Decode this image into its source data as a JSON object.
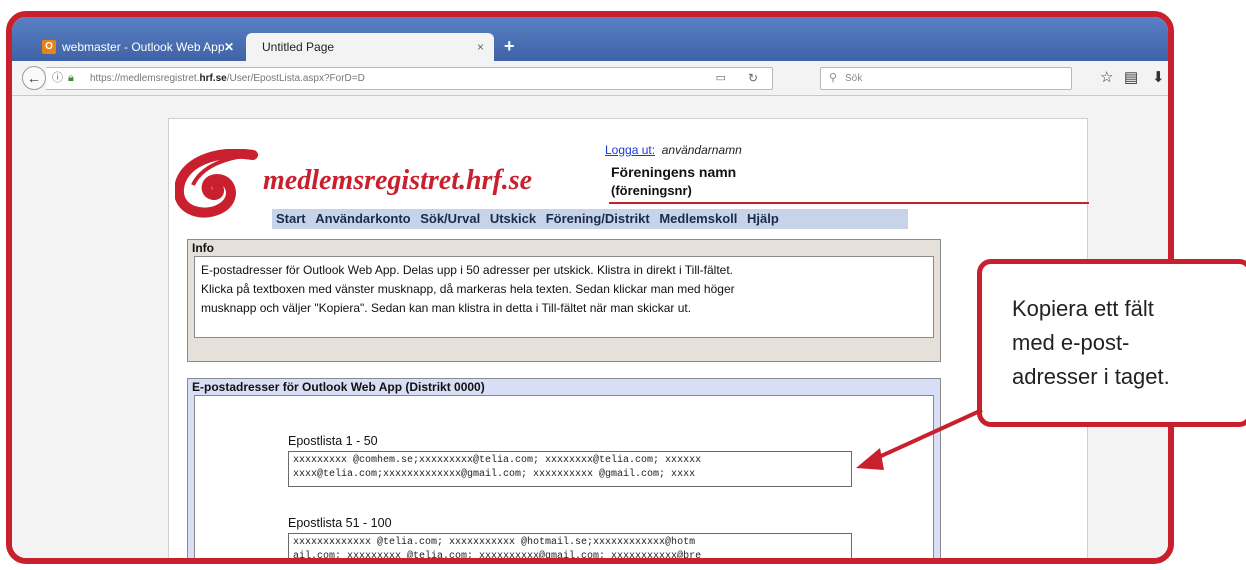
{
  "browser": {
    "tabs": [
      {
        "label": "webmaster - Outlook Web App",
        "icon": "outlook-icon",
        "close": "✕"
      },
      {
        "label": "Untitled Page",
        "close": "×"
      }
    ],
    "newtab": "+",
    "url_prefix": "https://medlemsregistret.",
    "url_domain": "hrf.se",
    "url_suffix": "/User/EpostLista.aspx?ForD=D",
    "search_placeholder": "Sök"
  },
  "header": {
    "logo_text": "medlemsregistret.hrf.se",
    "logout_link": "Logga ut:",
    "username": "användarnamn",
    "org_name": "Föreningens namn",
    "org_nr": "(föreningsnr)"
  },
  "menu": [
    "Start",
    "Användarkonto",
    "Sök/Urval",
    "Utskick",
    "Förening/Distrikt",
    "Medlemskoll",
    "Hjälp"
  ],
  "info": {
    "title": "Info",
    "line1": "E-postadresser för Outlook Web App. Delas upp i 50 adresser per utskick. Klistra in direkt i Till-fältet.",
    "line2": "Klicka på textboxen med vänster musknapp, då markeras hela texten. Sedan klickar man med höger",
    "line3": "musknapp och väljer \"Kopiera\". Sedan kan man klistra in detta i Till-fältet när man skickar ut."
  },
  "email": {
    "title": "E-postadresser för Outlook Web App (Distrikt 0000)",
    "lists": [
      {
        "label": "Epostlista 1 - 50",
        "line1": "xxxxxxxxx @comhem.se;xxxxxxxxx@telia.com; xxxxxxxx@telia.com; xxxxxx",
        "line2": "xxxx@telia.com;xxxxxxxxxxxxx@gmail.com; xxxxxxxxxx @gmail.com; xxxx"
      },
      {
        "label": "Epostlista 51 - 100",
        "line1": "xxxxxxxxxxxxx @telia.com; xxxxxxxxxxx @hotmail.se;xxxxxxxxxxxx@hotm",
        "line2": "ail.com; xxxxxxxxx @telia.com; xxxxxxxxxx@gmail.com; xxxxxxxxxxx@bre"
      }
    ]
  },
  "callout": {
    "line1": "Kopiera ett fält",
    "line2": "med e-post-",
    "line3": "adresser i taget."
  },
  "colors": {
    "accent_red": "#c8202c",
    "tabbar_blue": "#4a6fb2",
    "menu_bg": "#c7d3e8"
  }
}
